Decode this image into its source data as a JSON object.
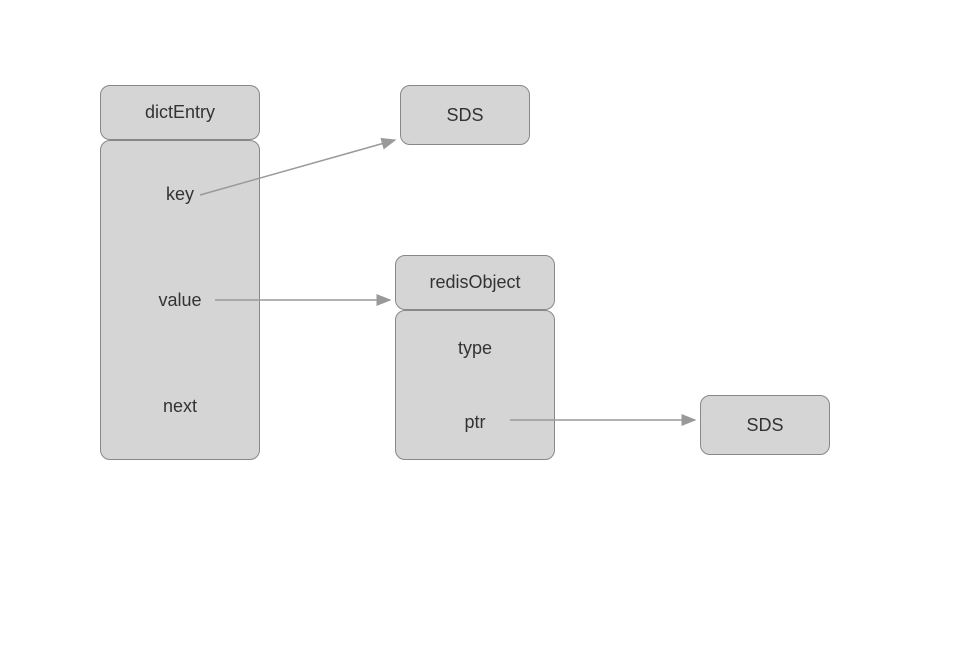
{
  "dictEntry": {
    "header": "dictEntry",
    "field1": "key",
    "field2": "value",
    "field3": "next"
  },
  "sds1": {
    "label": "SDS"
  },
  "redisObject": {
    "header": "redisObject",
    "field1": "type",
    "field2": "ptr"
  },
  "sds2": {
    "label": "SDS"
  }
}
